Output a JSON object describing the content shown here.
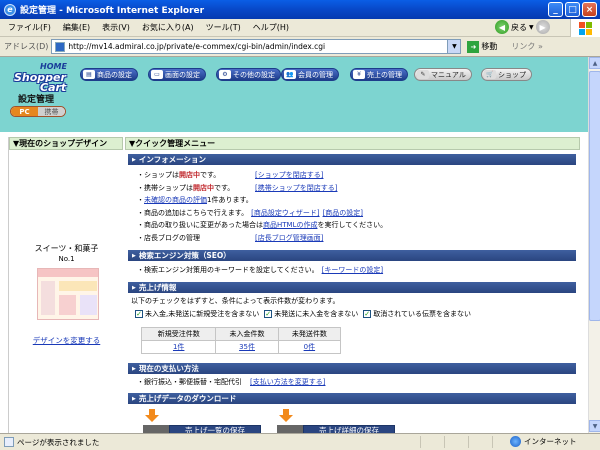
{
  "window": {
    "title": "設定管理 - Microsoft Internet Explorer"
  },
  "menu": [
    "ファイル(F)",
    "編集(E)",
    "表示(V)",
    "お気に入り(A)",
    "ツール(T)",
    "ヘルプ(H)"
  ],
  "toolbar": {
    "back_label": "戻る"
  },
  "address": {
    "label": "アドレス(D)",
    "url": "http://mv14.admiral.co.jp/private/e-commex/cgi-bin/admin/index.cgi",
    "go_label": "移動",
    "links_label": "リンク"
  },
  "logo": {
    "home": "HOME",
    "shopper": "Shopper",
    "cart": "Cart",
    "subtitle": "設定管理"
  },
  "nav": [
    {
      "label": "商品の設定"
    },
    {
      "label": "画面の設定"
    },
    {
      "label": "その他の設定"
    },
    {
      "label": "会員の管理"
    },
    {
      "label": "売上の管理"
    },
    {
      "label": "マニュアル"
    },
    {
      "label": "ショップ"
    }
  ],
  "mode": {
    "pc": "PC",
    "mobile": "携帯"
  },
  "left": {
    "header": "現在のショップデザイン",
    "design_name": "スイーツ・和菓子",
    "design_no": "No.1",
    "change_link": "デザインを変更する"
  },
  "main": {
    "header": "クイック管理メニュー",
    "info": {
      "title": "インフォメーション",
      "shop_pre": "・ショップは",
      "shop_status": "開店中",
      "shop_post": "です。",
      "shop_link": "[ショップを閉店する]",
      "mobile_pre": "・携帯ショップは",
      "mobile_status": "開店中",
      "mobile_post": "です。",
      "mobile_link": "[携帯ショップを閉店する]",
      "review_pre": "・",
      "review_link": "未確認の商品の評価",
      "review_post": " 1件あります。",
      "add_text": "・商品の追加はこちらで行えます。",
      "add_link1": "[商品設定ウィザード]",
      "add_link2": "[商品の設定]",
      "handling_pre": "・商品の取り扱いに変更があった場合は",
      "handling_link": "商品HTMLの作成",
      "handling_post": "を実行してください。",
      "blog_text": "・店長ブログの管理",
      "blog_link": "[店長ブログ管理画面]"
    },
    "seo": {
      "title": "検索エンジン対策（SEO）",
      "text": "・検索エンジン対策用のキーワードを設定してください。",
      "link": "[キーワードの設定]"
    },
    "sales": {
      "title": "売上げ情報",
      "desc": "以下のチェックをはずすと、条件によって表示件数が変わります。",
      "checks": [
        {
          "label": "未入金,未発送に新規受注を含まない"
        },
        {
          "label": "未発送に未入金を含まない"
        },
        {
          "label": "取消されている伝票を含まない"
        }
      ],
      "headers": [
        "新規受注件数",
        "未入金件数",
        "未発送件数"
      ],
      "values": [
        "1件",
        "35件",
        "0件"
      ]
    },
    "payment": {
      "title": "現在の支払い方法",
      "text": "・銀行振込・郵便振替・宅配代引",
      "link": "[支払い方法を変更する]"
    },
    "download": {
      "title": "売上げデータのダウンロード",
      "btn1": "売上げ一覧の保存",
      "btn2": "売上げ詳細の保存"
    }
  },
  "status": {
    "text": "ページが表示されました",
    "zone": "インターネット"
  }
}
